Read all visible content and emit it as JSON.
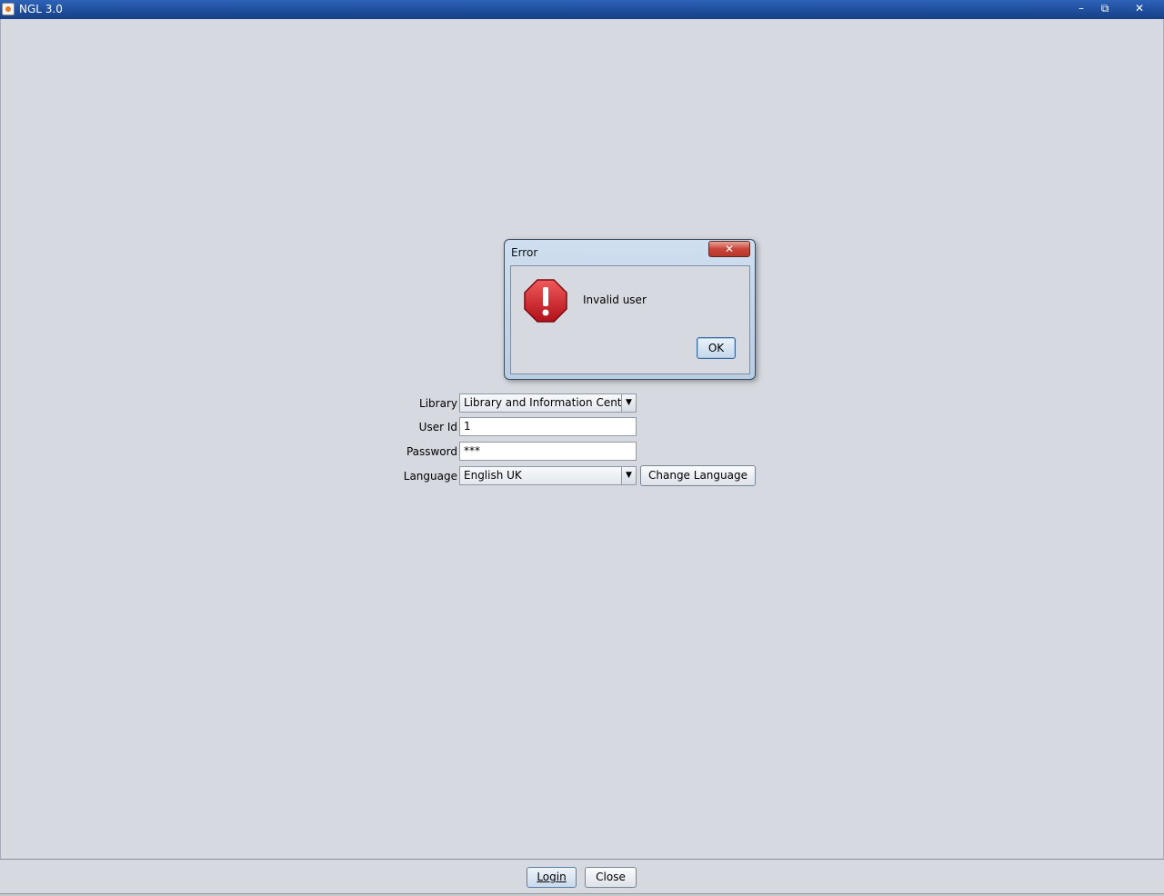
{
  "window": {
    "title": "NGL 3.0",
    "minimize_glyph": "–",
    "maximize_glyph": "⧉",
    "close_glyph": "✕"
  },
  "form": {
    "library_label": "Library",
    "library_value": "Library and Information Center",
    "userid_label": "User Id",
    "userid_value": "1",
    "password_label": "Password",
    "password_value": "***",
    "language_label": "Language",
    "language_value": "English UK",
    "change_language_label": "Change Language"
  },
  "footer": {
    "login_label": "Login",
    "close_label": "Close"
  },
  "dialog": {
    "title": "Error",
    "close_glyph": "✕",
    "message": "Invalid user",
    "ok_label": "OK",
    "icon": "error-stop-icon",
    "icon_color": "#d0202a"
  },
  "colors": {
    "titlebar": "#1f4e9c",
    "background": "#d6d9df"
  }
}
